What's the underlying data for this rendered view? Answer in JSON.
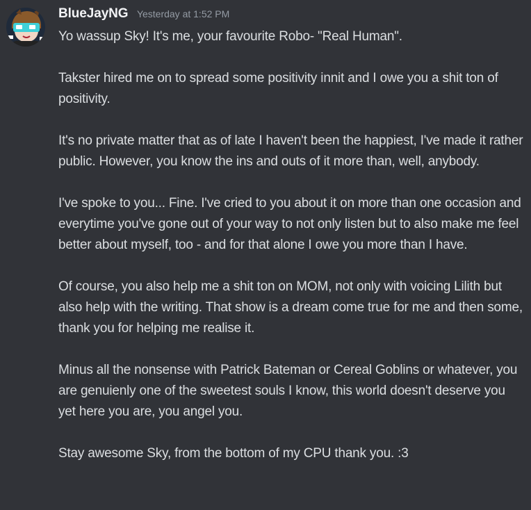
{
  "message": {
    "author": "BlueJayNG",
    "timestamp": "Yesterday at 1:52 PM",
    "avatar_icon": "bluejay-avatar-icon",
    "paragraphs": [
      "Yo wassup Sky! It's me, your favourite Robo- \"Real Human\".",
      "Takster hired me on to spread some positivity innit and I owe you a shit ton of positivity.",
      "It's no private matter that as of late I haven't been the happiest, I've made it rather public. However, you know the ins and outs of it more than, well, anybody.",
      "I've spoke to you... Fine. I've cried to you about it on more than one occasion and everytime you've gone out of your way to not only listen but to also make me feel better about myself, too - and for that alone I owe you more than I have.",
      "Of course, you also help me a shit ton on MOM, not only with voicing Lilith but also help with the writing. That show is a dream come true for me and then some, thank you for helping me realise it.",
      "Minus all the nonsense with Patrick Bateman or Cereal Goblins or whatever, you are genuienly one of the sweetest souls I know, this world doesn't deserve you yet here you are, you angel you.",
      "Stay awesome Sky, from the bottom of my CPU thank you. :3"
    ]
  },
  "colors": {
    "background": "#313338",
    "username": "#f2f3f5",
    "timestamp": "#949ba4",
    "text": "#dbdee1"
  }
}
